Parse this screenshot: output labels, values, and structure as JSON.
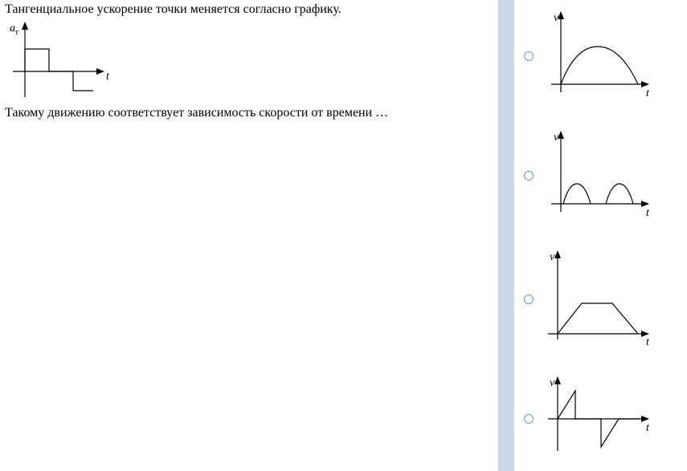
{
  "question": {
    "line1": "Тангенциальное ускорение точки меняется согласно графику.",
    "line2": "Такому движению соответствует зависимость скорости от времени …",
    "y_label": "a",
    "y_sub": "τ",
    "x_label": "t"
  },
  "options": [
    {
      "y_label": "v",
      "x_label": "t"
    },
    {
      "y_label": "v",
      "x_label": "t"
    },
    {
      "y_label": "v",
      "x_label": "t"
    },
    {
      "y_label": "v",
      "x_label": "t"
    }
  ],
  "chart_data": [
    {
      "type": "line",
      "role": "question-acceleration",
      "title": "",
      "xlabel": "t",
      "ylabel": "a_τ",
      "series": [
        {
          "name": "a_τ(t)",
          "segments": [
            {
              "t_range": [
                0,
                1
              ],
              "value": 1
            },
            {
              "t_range": [
                1,
                2
              ],
              "value": 0
            },
            {
              "t_range": [
                2,
                3
              ],
              "value": -1
            }
          ]
        }
      ]
    },
    {
      "type": "line",
      "role": "option-1-velocity",
      "xlabel": "t",
      "ylabel": "v",
      "description": "single smooth hump (half-sine) starting and ending at 0"
    },
    {
      "type": "line",
      "role": "option-2-velocity",
      "xlabel": "t",
      "ylabel": "v",
      "description": "two separated small humps"
    },
    {
      "type": "line",
      "role": "option-3-velocity",
      "xlabel": "t",
      "ylabel": "v",
      "description": "trapezoid: linear rise, flat plateau, linear fall"
    },
    {
      "type": "line",
      "role": "option-4-velocity",
      "xlabel": "t",
      "ylabel": "v",
      "description": "sawtooth crossing zero: rise, drop to 0, flat, drop below 0, rise back"
    }
  ]
}
